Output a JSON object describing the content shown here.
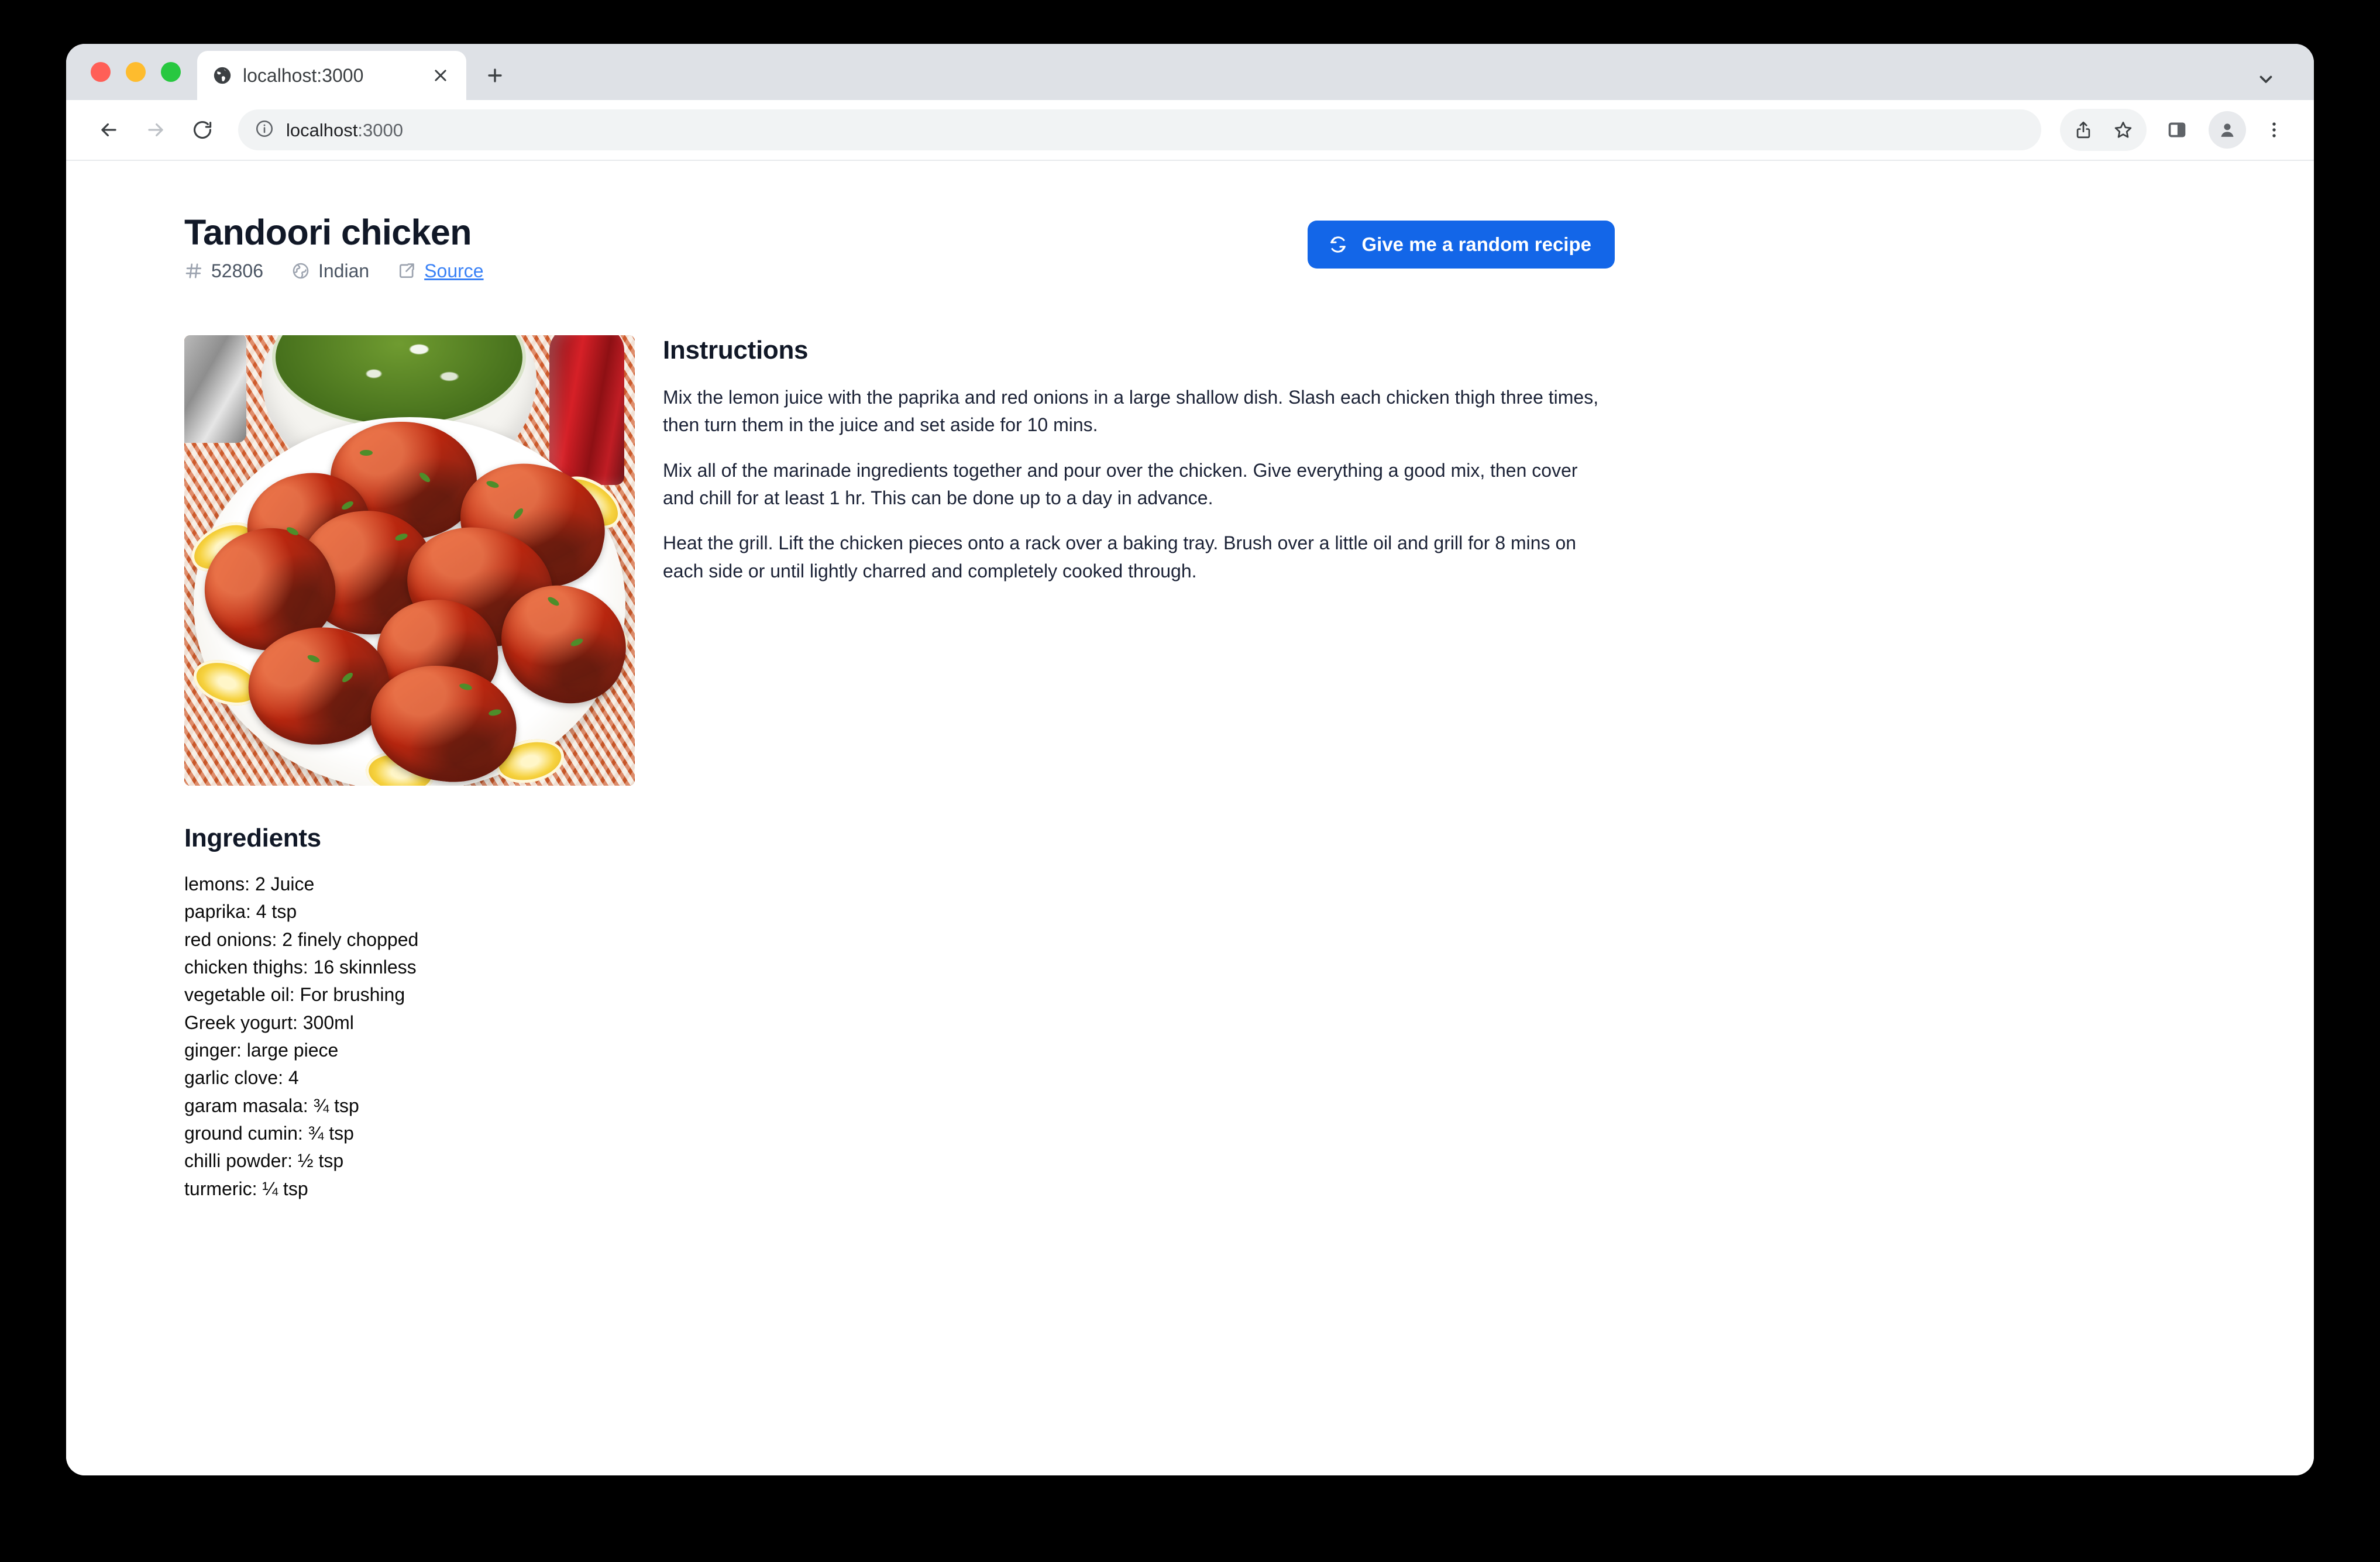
{
  "browser": {
    "tab": {
      "title": "localhost:3000",
      "favicon_icon": "globe-favicon",
      "close_icon": "close-icon"
    },
    "new_tab_icon": "plus-icon",
    "tabstrip_chevron_icon": "chevron-down-icon",
    "toolbar": {
      "back_icon": "back-arrow-icon",
      "forward_icon": "forward-arrow-icon",
      "reload_icon": "reload-icon",
      "site_info_icon": "info-circle-icon",
      "url_host": "localhost",
      "url_port": ":3000",
      "share_icon": "share-icon",
      "bookmark_icon": "star-icon",
      "side_panel_icon": "side-panel-icon",
      "profile_icon": "profile-avatar-icon",
      "menu_icon": "three-dot-menu-icon"
    },
    "traffic_lights": {
      "close": "#ff5f57",
      "minimize": "#febc2e",
      "maximize": "#28c840"
    }
  },
  "page": {
    "title": "Tandoori chicken",
    "meta": [
      {
        "icon": "hash-icon",
        "label": "52806",
        "link": false
      },
      {
        "icon": "globe-icon",
        "label": "Indian",
        "link": false
      },
      {
        "icon": "external-link-icon",
        "label": "Source",
        "link": true
      }
    ],
    "random_button": {
      "label": "Give me a random recipe",
      "icon": "refresh-icon",
      "color": "#1366e8"
    },
    "photo": {
      "alt": "Tandoori chicken pieces on a white plate with lemon slices and green chutney"
    },
    "instructions": {
      "heading": "Instructions",
      "paragraphs": [
        "Mix the lemon juice with the paprika and red onions in a large shallow dish. Slash each chicken thigh three times, then turn them in the juice and set aside for 10 mins.",
        "Mix all of the marinade ingredients together and pour over the chicken. Give everything a good mix, then cover and chill for at least 1 hr. This can be done up to a day in advance.",
        "Heat the grill. Lift the chicken pieces onto a rack over a baking tray. Brush over a little oil and grill for 8 mins on each side or until lightly charred and completely cooked through."
      ]
    },
    "ingredients": {
      "heading": "Ingredients",
      "items": [
        "lemons: 2 Juice",
        "paprika: 4 tsp",
        "red onions: 2 finely chopped",
        "chicken thighs: 16 skinnless",
        "vegetable oil: For brushing",
        "Greek yogurt: 300ml",
        "ginger: large piece",
        "garlic clove: 4",
        "garam masala: ¾ tsp",
        "ground cumin: ¾ tsp",
        "chilli powder: ½ tsp",
        "turmeric: ¼ tsp"
      ]
    }
  },
  "colors": {
    "accent": "#1366e8",
    "link": "#3b82f6",
    "heading": "#111827",
    "body_text": "#1b2236",
    "meta_text": "#4b5563"
  }
}
